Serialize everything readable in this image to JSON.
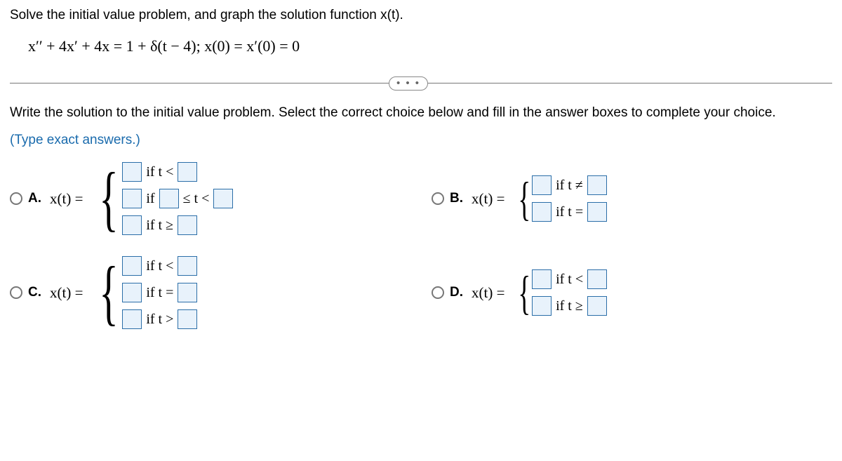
{
  "problem": {
    "statement": "Solve the initial value problem, and graph the solution function x(t).",
    "equation": "x′′ + 4x′ + 4x = 1 + δ(t − 4);    x(0) = x′(0) = 0"
  },
  "divider": {
    "ellipsis": "• • •"
  },
  "instruction": "Write the solution to the initial value problem. Select the correct choice below and fill in the answer boxes to complete your choice.",
  "hint": "(Type exact answers.)",
  "labels": {
    "A": "A.",
    "B": "B.",
    "C": "C.",
    "D": "D.",
    "xt_eq": "x(t) =",
    "if": "if",
    "if_t_lt": "if t <",
    "if_t_ge": "if t ≥",
    "if_t_eq": "if t =",
    "if_t_gt": "if t >",
    "if_t_ne": "if t ≠",
    "le_t_lt": "≤ t <"
  }
}
